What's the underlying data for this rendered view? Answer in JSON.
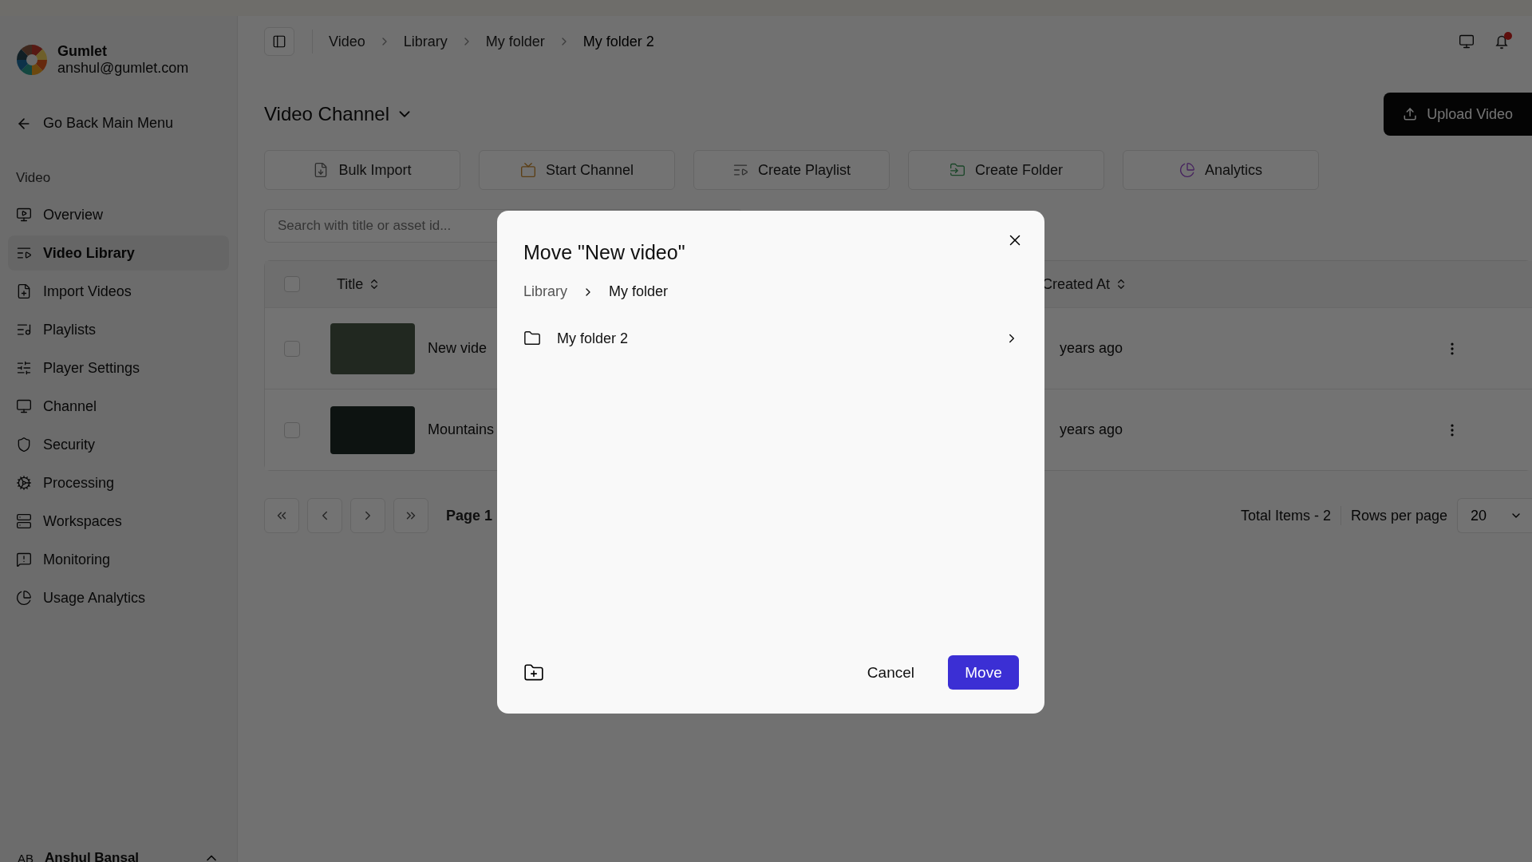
{
  "sidebar": {
    "org": "Gumlet",
    "email": "anshul@gumlet.com",
    "back": "Go Back Main Menu",
    "section": "Video",
    "items": [
      {
        "label": "Overview",
        "selected": false
      },
      {
        "label": "Video Library",
        "selected": true
      },
      {
        "label": "Import Videos",
        "selected": false
      },
      {
        "label": "Playlists",
        "selected": false
      },
      {
        "label": "Player Settings",
        "selected": false
      },
      {
        "label": "Channel",
        "selected": false
      },
      {
        "label": "Security",
        "selected": false
      },
      {
        "label": "Processing",
        "selected": false
      },
      {
        "label": "Workspaces",
        "selected": false
      },
      {
        "label": "Monitoring",
        "selected": false
      },
      {
        "label": "Usage Analytics",
        "selected": false
      }
    ],
    "user": {
      "initials": "AB",
      "name": "Anshul Bansal"
    }
  },
  "breadcrumb": [
    "Video",
    "Library",
    "My folder",
    "My folder 2"
  ],
  "page": {
    "title": "Video Channel",
    "upload": "Upload Video",
    "actions": [
      "Bulk Import",
      "Start Channel",
      "Create Playlist",
      "Create Folder",
      "Analytics"
    ],
    "search": {
      "placeholder": "Search with title or asset id..."
    },
    "columns": [
      "Title",
      "Created At"
    ],
    "all_checked": false,
    "rows": [
      {
        "title": "New vide",
        "created": "years ago",
        "checked": false
      },
      {
        "title": "Mountains",
        "created": "years ago",
        "checked": false
      }
    ],
    "pagination": {
      "page": "Page 1",
      "total": "Total Items - 2",
      "rows_label": "Rows per page",
      "rows_value": "20"
    }
  },
  "dialog": {
    "title": "Move \"New video\"",
    "path": [
      "Library",
      "My folder"
    ],
    "folders": [
      {
        "name": "My folder 2"
      }
    ],
    "cancel": "Cancel",
    "confirm": "Move"
  }
}
